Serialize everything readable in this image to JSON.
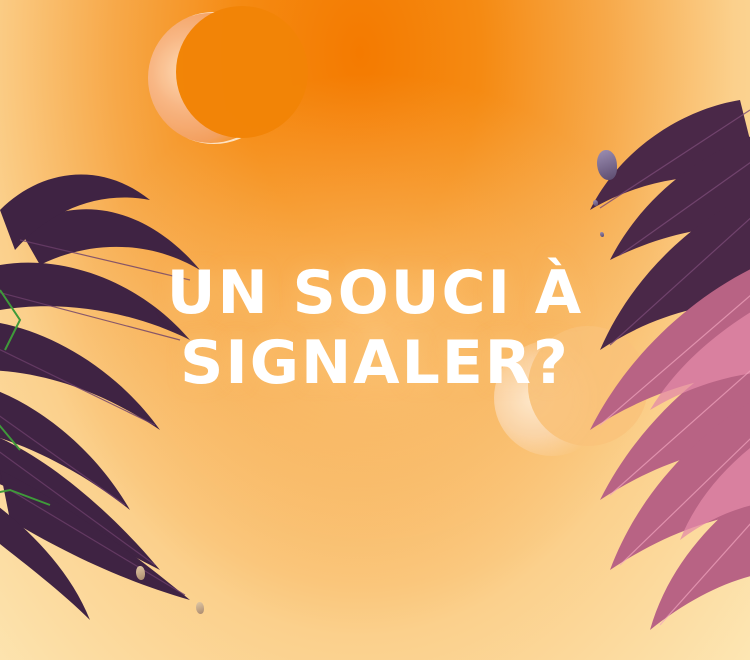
{
  "headline": {
    "line1": "UN SOUCI À",
    "line2": "SIGNALER?"
  },
  "colors": {
    "sky_top": "#f47a00",
    "sky_bottom": "#fde6b3",
    "palm_dark": "#4a2848",
    "palm_pink": "#d97a9a",
    "headline": "#ffffff"
  },
  "decor": {
    "left_palm": "palm-tree-dark",
    "right_palm": "palm-tree-pink",
    "moons": [
      "crescent-moon",
      "crescent-moon"
    ]
  }
}
